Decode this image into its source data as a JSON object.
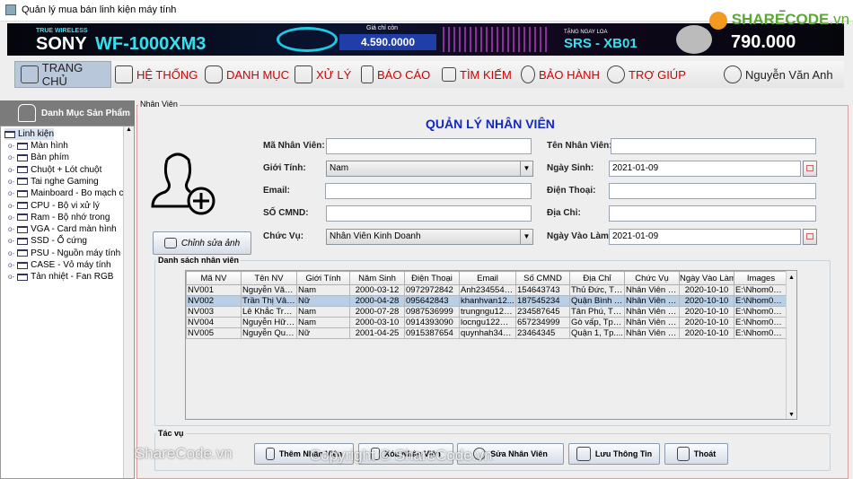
{
  "window": {
    "title": "Quản lý mua bán linh kiện máy tính",
    "controls": [
      "–",
      "☐",
      "✕"
    ]
  },
  "banner": {
    "line1": "TRUE WIRELESS",
    "brand": "SONY",
    "model": "WF-1000XM3",
    "price_label": "Giá chỉ còn",
    "price": "4.590.0000",
    "gift_label": "TẶNG NGAY LOA",
    "gift_model": "SRS - XB01",
    "gift_value": "790.000",
    "logo": "SHARECODE.vn"
  },
  "nav": {
    "items": [
      {
        "label": "TRANG CHỦ",
        "icon": "home-icon"
      },
      {
        "label": "HỆ THỐNG",
        "icon": "monitor-icon"
      },
      {
        "label": "DANH MỤC",
        "icon": "list-icon"
      },
      {
        "label": "XỬ LÝ",
        "icon": "process-icon"
      },
      {
        "label": "BÁO CÁO",
        "icon": "report-icon"
      },
      {
        "label": "TÌM KIẾM",
        "icon": "search-icon"
      },
      {
        "label": "BẢO HÀNH",
        "icon": "medal-icon"
      },
      {
        "label": "TRỢ GIÚP",
        "icon": "help-icon"
      }
    ],
    "user": "Nguyễn Văn Anh"
  },
  "sidebar": {
    "title": "Danh Mục Sản Phẩm",
    "root": "Linh kiện",
    "items": [
      "Màn hình",
      "Bàn phím",
      "Chuột + Lót chuột",
      "Tai nghe Gaming",
      "Mainboard - Bo mạch chủ",
      "CPU - Bộ vi xử lý",
      "Ram - Bộ nhớ trong",
      "VGA - Card màn hình",
      "SSD - Ổ cứng",
      "PSU - Nguồn máy tính",
      "CASE - Vỏ máy tính",
      "Tản nhiệt - Fan RGB"
    ]
  },
  "main": {
    "frame_title": "Nhân Viên",
    "heading": "QUẢN LÝ NHÂN VIÊN",
    "edit_photo": "Chỉnh sửa ảnh",
    "form": {
      "ma_nv": {
        "label": "Mã Nhân Viên:",
        "value": ""
      },
      "ten_nv": {
        "label": "Tên Nhân Viên:",
        "value": ""
      },
      "gioi_tinh": {
        "label": "Giới Tính:",
        "value": "Nam"
      },
      "ngay_sinh": {
        "label": "Ngày Sinh:",
        "value": "2021-01-09"
      },
      "email": {
        "label": "Email:",
        "value": ""
      },
      "dien_thoai": {
        "label": "Điện Thoại:",
        "value": ""
      },
      "cmnd": {
        "label": "SỐ CMND:",
        "value": ""
      },
      "dia_chi": {
        "label": "Địa Chỉ:",
        "value": ""
      },
      "chuc_vu": {
        "label": "Chức Vụ:",
        "value": "Nhân Viên Kinh Doanh"
      },
      "ngay_vao_lam": {
        "label": "Ngày Vào Làm:",
        "value": "2021-01-09"
      }
    },
    "table_title": "Danh sách nhân viên",
    "columns": [
      "Mã NV",
      "Tên NV",
      "Giới Tính",
      "Năm Sinh",
      "Điện Thoại",
      "Email",
      "Số CMND",
      "Địa Chỉ",
      "Chức Vụ",
      "Ngày Vào Làm",
      "Images"
    ],
    "rows": [
      [
        "NV001",
        "Nguyễn Văn ...",
        "Nam",
        "2000-03-12",
        "0972972842",
        "Anh2345543...",
        "154643743",
        "Thủ Đức, Tp....",
        "Nhân Viên Ki...",
        "2020-10-10",
        "E:\\Nhom01_..."
      ],
      [
        "NV002",
        "Trần Thị Vân...",
        "Nữ",
        "2000-04-28",
        "095642843",
        "khanhvan12...",
        "187545234",
        "Quận Bình T...",
        "Nhân Viên K...",
        "2020-10-10",
        "E:\\Nhom01_..."
      ],
      [
        "NV003",
        "Lê Khắc Trung",
        "Nam",
        "2000-07-28",
        "0987536999",
        "trungngu123...",
        "234587645",
        "Tân Phú, Tp....",
        "Nhân Viên K...",
        "2020-10-10",
        "E:\\Nhom01_..."
      ],
      [
        "NV004",
        "Nguyễn Hữu...",
        "Nam",
        "2000-03-10",
        "0914393090",
        "locngu122@...",
        "657234999",
        "Gò vấp, Tp.H...",
        "Nhân Viên K...",
        "2020-10-10",
        "E:\\Nhom01_..."
      ],
      [
        "NV005",
        "Nguyễn Quỳ...",
        "Nữ",
        "2001-04-25",
        "0915387654",
        "quynhah345...",
        "23464345",
        "Quận 1, Tp....",
        "Nhân Viên K...",
        "2020-10-10",
        "E:\\Nhom01_..."
      ]
    ],
    "selected_row": 1,
    "actions_title": "Tác vụ",
    "buttons": {
      "add": "Thêm Nhân Viên",
      "delete": "Xóa Nhân Viên",
      "edit": "Sửa Nhân Viên",
      "save": "Lưu Thông Tin",
      "exit": "Thoát"
    }
  },
  "watermark": {
    "left": "ShareCode.vn",
    "center": "Copyright © ShareCode.vn"
  }
}
